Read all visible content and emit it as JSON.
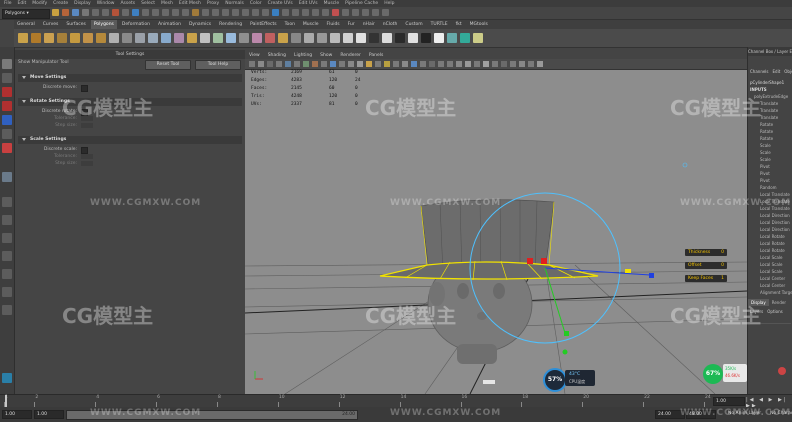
{
  "menubar": {
    "items": [
      "File",
      "Edit",
      "Modify",
      "Create",
      "Display",
      "Window",
      "Assets",
      "Select",
      "Mesh",
      "Edit Mesh",
      "Proxy",
      "Normals",
      "Color",
      "Create UVs",
      "Edit UVs",
      "Muscle",
      "Pipeline Cache",
      "Help"
    ]
  },
  "status": {
    "mode": "Polygons"
  },
  "shelf": {
    "tabs": [
      "General",
      "Curves",
      "Surfaces",
      "Polygons",
      "Deformation",
      "Animation",
      "Dynamics",
      "Rendering",
      "PaintEffects",
      "Toon",
      "Muscle",
      "Fluids",
      "Fur",
      "nHair",
      "nCloth",
      "Custom",
      "TURTLE",
      "fkt",
      "MGtools"
    ],
    "active_tab": "Polygons"
  },
  "tool_settings": {
    "title": "Tool Settings",
    "description": "Show Manipulator Tool",
    "reset_label": "Reset Tool",
    "help_label": "Tool Help",
    "sections": [
      {
        "title": "Move Settings",
        "rows": [
          {
            "label": "Discrete move:",
            "dim": false
          }
        ]
      },
      {
        "title": "Rotate Settings",
        "rows": [
          {
            "label": "Discrete rotate:",
            "dim": false
          },
          {
            "label": "Tolerance:",
            "dim": true
          },
          {
            "label": "Step size:",
            "dim": true
          }
        ]
      },
      {
        "title": "Scale Settings",
        "rows": [
          {
            "label": "Discrete scale:",
            "dim": false
          },
          {
            "label": "Tolerance:",
            "dim": true
          },
          {
            "label": "Step size:",
            "dim": true
          }
        ]
      }
    ]
  },
  "viewport": {
    "menu": [
      "View",
      "Shading",
      "Lighting",
      "Show",
      "Renderer",
      "Panels"
    ],
    "hud": [
      [
        "Verts:",
        "2169",
        "61",
        "0"
      ],
      [
        "Edges:",
        "4283",
        "120",
        "24"
      ],
      [
        "Faces:",
        "2145",
        "60",
        "0"
      ],
      [
        "Tris:",
        "4248",
        "120",
        "0"
      ],
      [
        "UVs:",
        "2337",
        "81",
        "0"
      ]
    ],
    "channel_labels": [
      {
        "name": "Thickness",
        "value": "0"
      },
      {
        "name": "Offset",
        "value": "0"
      },
      {
        "name": "Keep Faces",
        "value": "1"
      }
    ]
  },
  "channel_box": {
    "title": "Channel Box / Layer Editor",
    "menu": [
      "Channels",
      "Edit",
      "Object"
    ],
    "object": "pCylinderShape1",
    "inputs_label": "INPUTS",
    "items": [
      "polyExtrudeEdge",
      "Translate",
      "Translate",
      "Translate",
      "Rotate",
      "Rotate",
      "Rotate",
      "Scale",
      "Scale",
      "Scale",
      "Pivot",
      "Pivot",
      "Pivot",
      "Random",
      "Local Translate",
      "Local Translate",
      "Local Translate",
      "Local Direction",
      "Local Direction",
      "Local Direction",
      "Local Rotate",
      "Local Rotate",
      "Local Rotate",
      "Local Scale",
      "Local Scale",
      "Local Scale",
      "Local Center",
      "Local Center",
      "Alignment Target"
    ],
    "tabs": [
      "Display",
      "Render"
    ],
    "layer_menu": [
      "Layers",
      "Options"
    ]
  },
  "perf_widget": {
    "percent": "57",
    "temp": "43°C",
    "label": "CPU温度"
  },
  "net_widget": {
    "percent": "67",
    "up": "35K/s",
    "down": "46.6K/s"
  },
  "timeline": {
    "ticks": [
      "1",
      "2",
      "4",
      "6",
      "8",
      "10",
      "12",
      "14",
      "16",
      "18",
      "20",
      "22",
      "24"
    ],
    "current_frame": "1.00"
  },
  "range": {
    "start": "1.00",
    "playback_start": "1.00",
    "playback_end": "24.00",
    "end": "24.00",
    "end_max": "48.00",
    "anim_layer": "No Anim Layer",
    "char_set": "No Character Set"
  },
  "watermark": {
    "brand": "CG模型主",
    "url": "WWW.CGMXW.COM"
  },
  "colors": {
    "yellow_outline": "#f1e200",
    "manip_circle": "#4ec1ff",
    "hud_bg": "#2c2c2c",
    "accent_green": "#1db954"
  }
}
